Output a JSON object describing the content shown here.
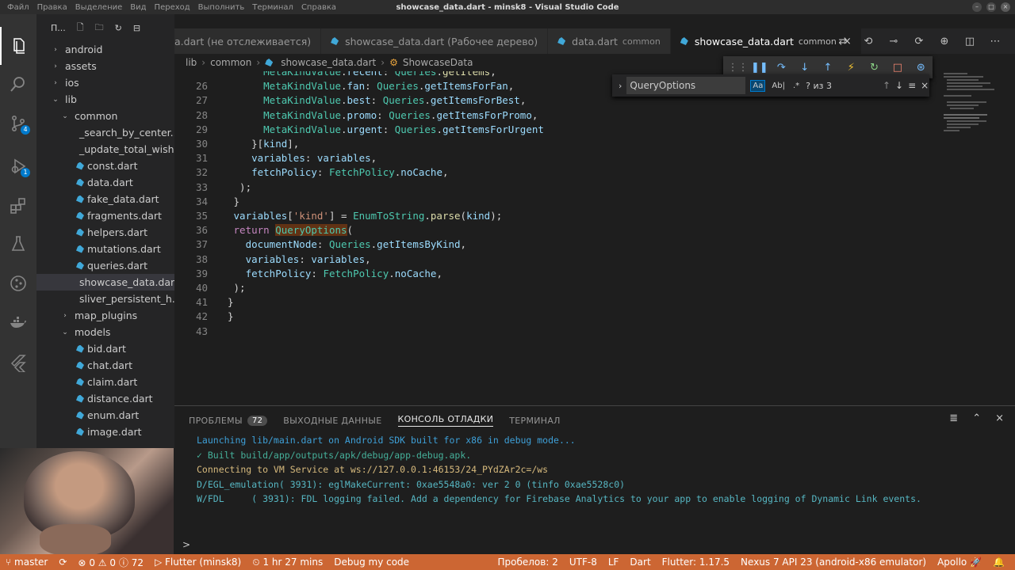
{
  "titlebar": {
    "menu": [
      "Файл",
      "Правка",
      "Выделение",
      "Вид",
      "Переход",
      "Выполнить",
      "Терминал",
      "Справка"
    ],
    "title": "showcase_data.dart - minsk8 - Visual Studio Code"
  },
  "activity_bar": {
    "items": [
      {
        "name": "explorer-icon"
      },
      {
        "name": "search-icon"
      },
      {
        "name": "source-control-icon",
        "badge": "4"
      },
      {
        "name": "run-debug-icon",
        "badge": "1"
      },
      {
        "name": "extensions-icon"
      },
      {
        "name": "testing-icon"
      },
      {
        "name": "git-graph-icon"
      },
      {
        "name": "docker-icon"
      },
      {
        "name": "flutter-icon"
      }
    ]
  },
  "sidebar": {
    "header": "П...",
    "tree": [
      {
        "label": "android",
        "type": "folder",
        "open": false,
        "indent": 0
      },
      {
        "label": "assets",
        "type": "folder",
        "open": false,
        "indent": 0
      },
      {
        "label": "ios",
        "type": "folder",
        "open": false,
        "indent": 0
      },
      {
        "label": "lib",
        "type": "folder",
        "open": true,
        "indent": 0
      },
      {
        "label": "common",
        "type": "folder",
        "open": true,
        "indent": 1
      },
      {
        "label": "_search_by_center....",
        "type": "style",
        "indent": 2
      },
      {
        "label": "_update_total_wish...",
        "type": "style",
        "indent": 2
      },
      {
        "label": "const.dart",
        "type": "dart",
        "indent": 2
      },
      {
        "label": "data.dart",
        "type": "dart",
        "indent": 2
      },
      {
        "label": "fake_data.dart",
        "type": "dart",
        "indent": 2
      },
      {
        "label": "fragments.dart",
        "type": "dart",
        "indent": 2
      },
      {
        "label": "helpers.dart",
        "type": "dart",
        "indent": 2
      },
      {
        "label": "mutations.dart",
        "type": "dart",
        "indent": 2
      },
      {
        "label": "queries.dart",
        "type": "dart",
        "indent": 2
      },
      {
        "label": "showcase_data.dart",
        "type": "dart",
        "indent": 2,
        "selected": true
      },
      {
        "label": "sliver_persistent_h...",
        "type": "dart",
        "indent": 2
      },
      {
        "label": "map_plugins",
        "type": "folder",
        "open": false,
        "indent": 1
      },
      {
        "label": "models",
        "type": "folder",
        "open": true,
        "indent": 1
      },
      {
        "label": "bid.dart",
        "type": "dart",
        "indent": 2
      },
      {
        "label": "chat.dart",
        "type": "dart",
        "indent": 2
      },
      {
        "label": "claim.dart",
        "type": "dart",
        "indent": 2
      },
      {
        "label": "distance.dart",
        "type": "dart",
        "indent": 2
      },
      {
        "label": "enum.dart",
        "type": "dart",
        "indent": 2
      },
      {
        "label": "image.dart",
        "type": "dart",
        "indent": 2
      }
    ]
  },
  "tabs": [
    {
      "label": "a.dart (не отслеживается)",
      "desc": "",
      "active": false
    },
    {
      "label": "showcase_data.dart (Рабочее дерево)",
      "desc": "",
      "active": false
    },
    {
      "label": "data.dart",
      "desc": "common",
      "active": false
    },
    {
      "label": "showcase_data.dart",
      "desc": "common",
      "active": true
    }
  ],
  "breadcrumb": [
    "lib",
    "common",
    "showcase_data.dart",
    "ShowcaseData"
  ],
  "find": {
    "value": "QueryOptions",
    "options": [
      "Aa",
      "Ab|",
      ".*"
    ],
    "result": "? из 3"
  },
  "code_lines": [
    {
      "n": "",
      "html": "      <span class='ty'>MetaKindValue</span>.<span class='var'>recent</span>: <span class='ty'>Queries</span>.<span class='fn'>getItems</span>,"
    },
    {
      "n": "26",
      "html": "      <span class='ty'>MetaKindValue</span>.<span class='var'>fan</span>: <span class='ty'>Queries</span>.<span class='var'>getItemsForFan</span>,"
    },
    {
      "n": "27",
      "html": "      <span class='ty'>MetaKindValue</span>.<span class='var'>best</span>: <span class='ty'>Queries</span>.<span class='var'>getItemsForBest</span>,"
    },
    {
      "n": "28",
      "html": "      <span class='ty'>MetaKindValue</span>.<span class='var'>promo</span>: <span class='ty'>Queries</span>.<span class='var'>getItemsForPromo</span>,"
    },
    {
      "n": "29",
      "html": "      <span class='ty'>MetaKindValue</span>.<span class='var'>urgent</span>: <span class='ty'>Queries</span>.<span class='var'>getItemsForUrgent</span>"
    },
    {
      "n": "30",
      "html": "    }[<span class='var'>kind</span>],"
    },
    {
      "n": "31",
      "html": "    <span class='var'>variables</span>: <span class='var'>variables</span>,"
    },
    {
      "n": "32",
      "html": "    <span class='var'>fetchPolicy</span>: <span class='ty'>FetchPolicy</span>.<span class='var'>noCache</span>,"
    },
    {
      "n": "33",
      "html": "  );"
    },
    {
      "n": "34",
      "html": " }"
    },
    {
      "n": "35",
      "html": " <span class='var'>variables</span>[<span class='str'>'kind'</span>] = <span class='ty'>EnumToString</span>.<span class='fn'>parse</span>(<span class='var'>kind</span>);"
    },
    {
      "n": "36",
      "html": " <span class='kw'>return</span> <span class='hl'>QueryOptions</span>("
    },
    {
      "n": "37",
      "html": "   <span class='var'>documentNode</span>: <span class='ty'>Queries</span>.<span class='var'>getItemsByKind</span>,"
    },
    {
      "n": "38",
      "html": "   <span class='var'>variables</span>: <span class='var'>variables</span>,"
    },
    {
      "n": "39",
      "html": "   <span class='var'>fetchPolicy</span>: <span class='ty'>FetchPolicy</span>.<span class='var'>noCache</span>,"
    },
    {
      "n": "40",
      "html": " );"
    },
    {
      "n": "41",
      "html": "}"
    },
    {
      "n": "42",
      "html": "}"
    },
    {
      "n": "43",
      "html": ""
    }
  ],
  "panel": {
    "tabs": [
      {
        "label": "ПРОБЛЕМЫ",
        "badge": "72",
        "active": false
      },
      {
        "label": "ВЫХОДНЫЕ ДАННЫЕ",
        "badge": "",
        "active": false
      },
      {
        "label": "КОНСОЛЬ ОТЛАДКИ",
        "badge": "",
        "active": true
      },
      {
        "label": "ТЕРМИНАЛ",
        "badge": "",
        "active": false
      }
    ],
    "console": [
      {
        "text": "Launching lib/main.dart on Android SDK built for x86 in debug mode...",
        "color": "c-blue"
      },
      {
        "text": "✓ Built build/app/outputs/apk/debug/app-debug.apk.",
        "color": "c-green"
      },
      {
        "text": "Connecting to VM Service at ws://127.0.0.1:46153/24_PYdZAr2c=/ws",
        "color": "c-yellow"
      },
      {
        "text": "D/EGL_emulation( 3931): eglMakeCurrent: 0xae5548a0: ver 2 0 (tinfo 0xae5528c0)",
        "color": "c-cyan"
      },
      {
        "text": "W/FDL     ( 3931): FDL logging failed. Add a dependency for Firebase Analytics to your app to enable logging of Dynamic Link events.",
        "color": "c-cyan"
      }
    ],
    "prompt": ">"
  },
  "statusbar": {
    "branch": "master",
    "errors": "0",
    "warnings": "0",
    "infos": "72",
    "debug_target": "Flutter (minsk8)",
    "timer": "1 hr 27 mins",
    "debug_mode": "Debug my code",
    "spaces": "Пробелов: 2",
    "encoding": "UTF-8",
    "eol": "LF",
    "language": "Dart",
    "flutter": "Flutter: 1.17.5",
    "device": "Nexus 7 API 23 (android-x86 emulator)",
    "apollo": "Apollo"
  },
  "colors": {
    "statusbar": "#cc6633",
    "accent": "#007acc"
  }
}
